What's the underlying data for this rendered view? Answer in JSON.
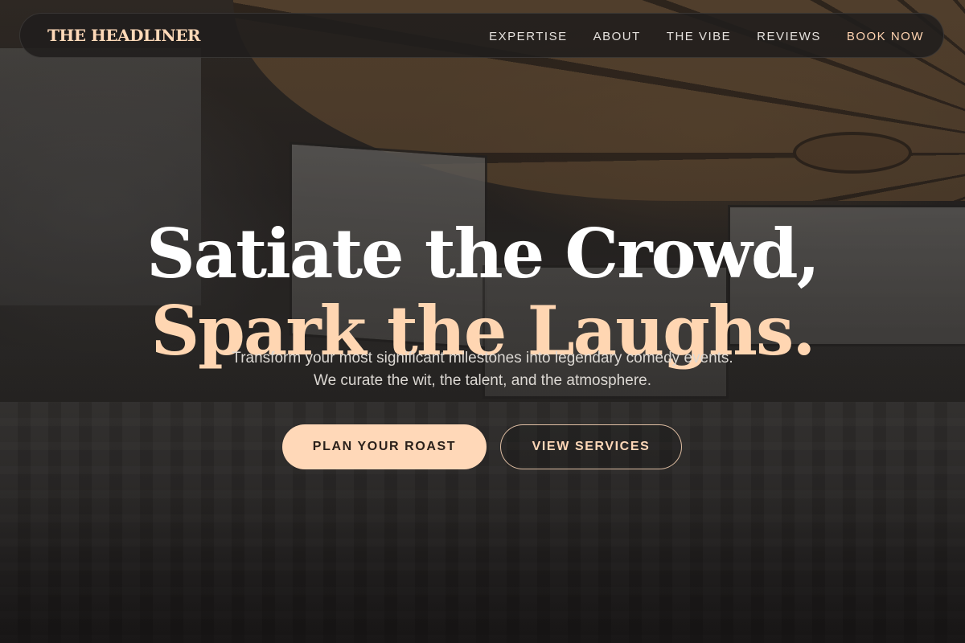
{
  "nav": {
    "logo": "THE HEADLINER",
    "links": [
      "EXPERTISE",
      "ABOUT",
      "THE VIBE",
      "REVIEWS",
      "BOOK NOW"
    ]
  },
  "hero": {
    "headline_line1": "Satiate the Crowd,",
    "headline_line2": "Spark the Laughs.",
    "subtitle": "Transform your most significant milestones into legendary comedy events. We curate the wit, the talent, and the atmosphere.",
    "primary_cta": "PLAN YOUR ROAST",
    "secondary_cta": "VIEW SERVICES"
  },
  "colors": {
    "accent": "#ffd8b8",
    "nav_background": "#201e1d",
    "headline_white": "#ffffff"
  }
}
